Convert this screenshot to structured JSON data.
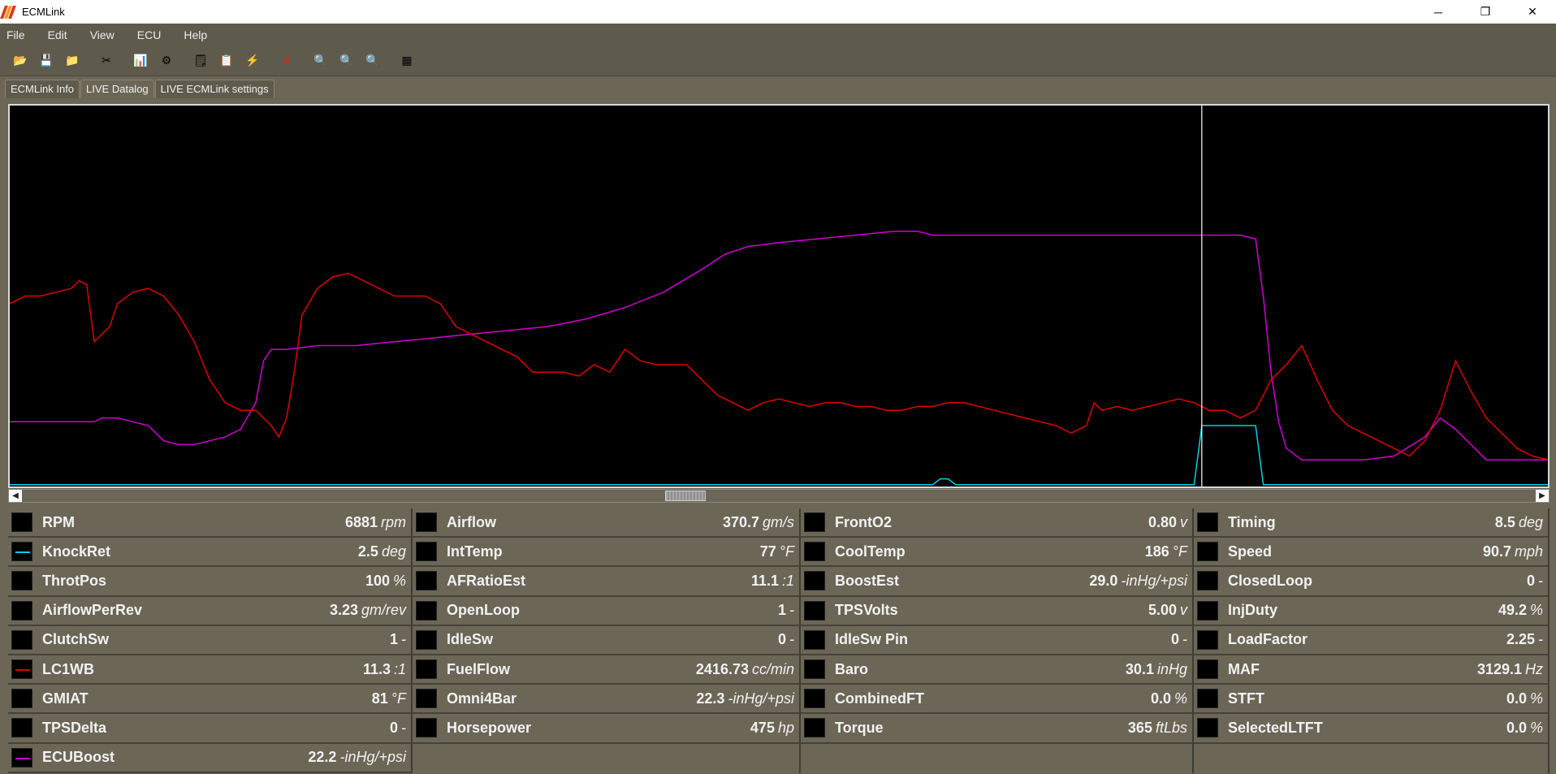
{
  "window": {
    "title": "ECMLink",
    "minimize": "─",
    "maximize": "❐",
    "close": "✕"
  },
  "menu": [
    "File",
    "Edit",
    "View",
    "ECU",
    "Help"
  ],
  "toolbar": [
    {
      "icon": "open-folder-icon",
      "glyph": "📂"
    },
    {
      "icon": "save-icon",
      "glyph": "💾"
    },
    {
      "icon": "open-log-icon",
      "glyph": "📁"
    },
    {
      "icon": "tools-icon",
      "glyph": "✂"
    },
    {
      "icon": "chart-icon",
      "glyph": "📊"
    },
    {
      "icon": "ecu-connect-icon",
      "glyph": "⚙"
    },
    {
      "icon": "settings-icon",
      "glyph": "🗒"
    },
    {
      "icon": "export-icon",
      "glyph": "📋"
    },
    {
      "icon": "sweep-icon",
      "glyph": "⚡"
    },
    {
      "icon": "delete-icon",
      "glyph": "✕",
      "color": "#e02020"
    },
    {
      "icon": "zoom-1-icon",
      "glyph": "🔍"
    },
    {
      "icon": "zoom-fit-icon",
      "glyph": "🔍"
    },
    {
      "icon": "zoom-out-icon",
      "glyph": "🔍"
    },
    {
      "icon": "map-icon",
      "glyph": "▦"
    }
  ],
  "tabs": [
    {
      "label": "ECMLink Info",
      "active": false
    },
    {
      "label": "LIVE Datalog",
      "active": true
    },
    {
      "label": "LIVE ECMLink settings",
      "active": false
    }
  ],
  "colors": {
    "knockret": "#00d0e0",
    "lc1wb": "#e00000",
    "ecuboost": "#d000d0",
    "cursor": "#ffffff"
  },
  "chart_data": {
    "type": "line",
    "grid": false,
    "x_range": [
      0,
      200
    ],
    "y_range": [
      0,
      100
    ],
    "cursor_x": 155,
    "series": [
      {
        "name": "ECUBoost",
        "color": "#d000d0",
        "points": [
          [
            0,
            17
          ],
          [
            11,
            17
          ],
          [
            12,
            18
          ],
          [
            14,
            18
          ],
          [
            16,
            17
          ],
          [
            18,
            16
          ],
          [
            20,
            12
          ],
          [
            22,
            11
          ],
          [
            24,
            11
          ],
          [
            26,
            12
          ],
          [
            28,
            13
          ],
          [
            30,
            15
          ],
          [
            32,
            22
          ],
          [
            33,
            33
          ],
          [
            34,
            36
          ],
          [
            36,
            36
          ],
          [
            40,
            37
          ],
          [
            45,
            37
          ],
          [
            50,
            38
          ],
          [
            55,
            39
          ],
          [
            60,
            40
          ],
          [
            65,
            41
          ],
          [
            70,
            42
          ],
          [
            75,
            44
          ],
          [
            80,
            47
          ],
          [
            85,
            51
          ],
          [
            90,
            57
          ],
          [
            93,
            61
          ],
          [
            96,
            63
          ],
          [
            100,
            64
          ],
          [
            105,
            65
          ],
          [
            110,
            66
          ],
          [
            115,
            67
          ],
          [
            118,
            67
          ],
          [
            120,
            66
          ],
          [
            125,
            66
          ],
          [
            130,
            66
          ],
          [
            135,
            66
          ],
          [
            140,
            66
          ],
          [
            145,
            66
          ],
          [
            150,
            66
          ],
          [
            155,
            66
          ],
          [
            160,
            66
          ],
          [
            162,
            65
          ],
          [
            163,
            50
          ],
          [
            164,
            30
          ],
          [
            165,
            17
          ],
          [
            166,
            10
          ],
          [
            168,
            7
          ],
          [
            172,
            7
          ],
          [
            176,
            7
          ],
          [
            180,
            8
          ],
          [
            184,
            13
          ],
          [
            186,
            18
          ],
          [
            188,
            15
          ],
          [
            190,
            11
          ],
          [
            192,
            7
          ],
          [
            195,
            7
          ],
          [
            198,
            7
          ],
          [
            200,
            7
          ]
        ]
      },
      {
        "name": "LC1WB",
        "color": "#e00000",
        "points": [
          [
            0,
            48
          ],
          [
            2,
            50
          ],
          [
            4,
            50
          ],
          [
            6,
            51
          ],
          [
            8,
            52
          ],
          [
            9,
            54
          ],
          [
            10,
            53
          ],
          [
            11,
            38
          ],
          [
            12,
            40
          ],
          [
            13,
            42
          ],
          [
            14,
            48
          ],
          [
            16,
            51
          ],
          [
            18,
            52
          ],
          [
            20,
            50
          ],
          [
            22,
            45
          ],
          [
            24,
            38
          ],
          [
            26,
            28
          ],
          [
            28,
            22
          ],
          [
            30,
            20
          ],
          [
            32,
            20
          ],
          [
            34,
            16
          ],
          [
            35,
            13
          ],
          [
            36,
            18
          ],
          [
            37,
            30
          ],
          [
            38,
            45
          ],
          [
            40,
            52
          ],
          [
            42,
            55
          ],
          [
            44,
            56
          ],
          [
            46,
            54
          ],
          [
            48,
            52
          ],
          [
            50,
            50
          ],
          [
            52,
            50
          ],
          [
            54,
            50
          ],
          [
            56,
            48
          ],
          [
            58,
            42
          ],
          [
            60,
            40
          ],
          [
            62,
            38
          ],
          [
            64,
            36
          ],
          [
            66,
            34
          ],
          [
            68,
            30
          ],
          [
            70,
            30
          ],
          [
            72,
            30
          ],
          [
            74,
            29
          ],
          [
            76,
            32
          ],
          [
            78,
            30
          ],
          [
            80,
            36
          ],
          [
            82,
            33
          ],
          [
            84,
            32
          ],
          [
            86,
            32
          ],
          [
            88,
            32
          ],
          [
            90,
            28
          ],
          [
            92,
            24
          ],
          [
            94,
            22
          ],
          [
            96,
            20
          ],
          [
            98,
            22
          ],
          [
            100,
            23
          ],
          [
            102,
            22
          ],
          [
            104,
            21
          ],
          [
            106,
            22
          ],
          [
            108,
            22
          ],
          [
            110,
            21
          ],
          [
            112,
            21
          ],
          [
            114,
            20
          ],
          [
            116,
            20
          ],
          [
            118,
            21
          ],
          [
            120,
            21
          ],
          [
            122,
            22
          ],
          [
            124,
            22
          ],
          [
            126,
            21
          ],
          [
            128,
            20
          ],
          [
            130,
            19
          ],
          [
            132,
            18
          ],
          [
            134,
            17
          ],
          [
            136,
            16
          ],
          [
            138,
            14
          ],
          [
            140,
            16
          ],
          [
            141,
            22
          ],
          [
            142,
            20
          ],
          [
            144,
            21
          ],
          [
            146,
            20
          ],
          [
            148,
            21
          ],
          [
            150,
            22
          ],
          [
            152,
            23
          ],
          [
            154,
            22
          ],
          [
            156,
            20
          ],
          [
            158,
            20
          ],
          [
            160,
            18
          ],
          [
            162,
            20
          ],
          [
            164,
            28
          ],
          [
            166,
            32
          ],
          [
            168,
            37
          ],
          [
            170,
            28
          ],
          [
            172,
            20
          ],
          [
            174,
            16
          ],
          [
            176,
            14
          ],
          [
            178,
            12
          ],
          [
            180,
            10
          ],
          [
            182,
            8
          ],
          [
            184,
            12
          ],
          [
            186,
            20
          ],
          [
            188,
            33
          ],
          [
            190,
            25
          ],
          [
            192,
            18
          ],
          [
            194,
            14
          ],
          [
            196,
            10
          ],
          [
            198,
            8
          ],
          [
            200,
            7
          ]
        ]
      },
      {
        "name": "KnockRet",
        "color": "#00d0e0",
        "points": [
          [
            0,
            0.5
          ],
          [
            120,
            0.5
          ],
          [
            121,
            2
          ],
          [
            122,
            2
          ],
          [
            123,
            0.5
          ],
          [
            154,
            0.5
          ],
          [
            155,
            16
          ],
          [
            157,
            16
          ],
          [
            162,
            16
          ],
          [
            163,
            0.5
          ],
          [
            200,
            0.5
          ]
        ]
      }
    ]
  },
  "params": [
    [
      {
        "name": "RPM",
        "value": "6881",
        "unit": "rpm",
        "line": null
      },
      {
        "name": "KnockRet",
        "value": "2.5",
        "unit": "deg",
        "line": "#00d0e0"
      },
      {
        "name": "ThrotPos",
        "value": "100",
        "unit": "%",
        "line": null
      },
      {
        "name": "AirflowPerRev",
        "value": "3.23",
        "unit": "gm/rev",
        "line": null
      },
      {
        "name": "ClutchSw",
        "value": "1",
        "unit": "-",
        "line": null
      },
      {
        "name": "LC1WB",
        "value": "11.3",
        "unit": ":1",
        "line": "#e00000"
      },
      {
        "name": "GMIAT",
        "value": "81",
        "unit": "°F",
        "line": null
      },
      {
        "name": "TPSDelta",
        "value": "0",
        "unit": "-",
        "line": null
      },
      {
        "name": "ECUBoost",
        "value": "22.2",
        "unit": "-inHg/+psi",
        "line": "#d000d0"
      }
    ],
    [
      {
        "name": "Airflow",
        "value": "370.7",
        "unit": "gm/s",
        "line": null
      },
      {
        "name": "IntTemp",
        "value": "77",
        "unit": "°F",
        "line": null
      },
      {
        "name": "AFRatioEst",
        "value": "11.1",
        "unit": ":1",
        "line": null
      },
      {
        "name": "OpenLoop",
        "value": "1",
        "unit": "-",
        "line": null
      },
      {
        "name": "IdleSw",
        "value": "0",
        "unit": "-",
        "line": null
      },
      {
        "name": "FuelFlow",
        "value": "2416.73",
        "unit": "cc/min",
        "line": null
      },
      {
        "name": "Omni4Bar",
        "value": "22.3",
        "unit": "-inHg/+psi",
        "line": null
      },
      {
        "name": "Horsepower",
        "value": "475",
        "unit": "hp",
        "line": null
      },
      null
    ],
    [
      {
        "name": "FrontO2",
        "value": "0.80",
        "unit": "v",
        "line": null
      },
      {
        "name": "CoolTemp",
        "value": "186",
        "unit": "°F",
        "line": null
      },
      {
        "name": "BoostEst",
        "value": "29.0",
        "unit": "-inHg/+psi",
        "line": null
      },
      {
        "name": "TPSVolts",
        "value": "5.00",
        "unit": "v",
        "line": null
      },
      {
        "name": "IdleSw Pin",
        "value": "0",
        "unit": "-",
        "line": null
      },
      {
        "name": "Baro",
        "value": "30.1",
        "unit": "inHg",
        "line": null
      },
      {
        "name": "CombinedFT",
        "value": "0.0",
        "unit": "%",
        "line": null
      },
      {
        "name": "Torque",
        "value": "365",
        "unit": "ftLbs",
        "line": null
      },
      null
    ],
    [
      {
        "name": "Timing",
        "value": "8.5",
        "unit": "deg",
        "line": null
      },
      {
        "name": "Speed",
        "value": "90.7",
        "unit": "mph",
        "line": null
      },
      {
        "name": "ClosedLoop",
        "value": "0",
        "unit": "-",
        "line": null
      },
      {
        "name": "InjDuty",
        "value": "49.2",
        "unit": "%",
        "line": null
      },
      {
        "name": "LoadFactor",
        "value": "2.25",
        "unit": "-",
        "line": null
      },
      {
        "name": "MAF",
        "value": "3129.1",
        "unit": "Hz",
        "line": null
      },
      {
        "name": "STFT",
        "value": "0.0",
        "unit": "%",
        "line": null
      },
      {
        "name": "SelectedLTFT",
        "value": "0.0",
        "unit": "%",
        "line": null
      },
      null
    ]
  ]
}
